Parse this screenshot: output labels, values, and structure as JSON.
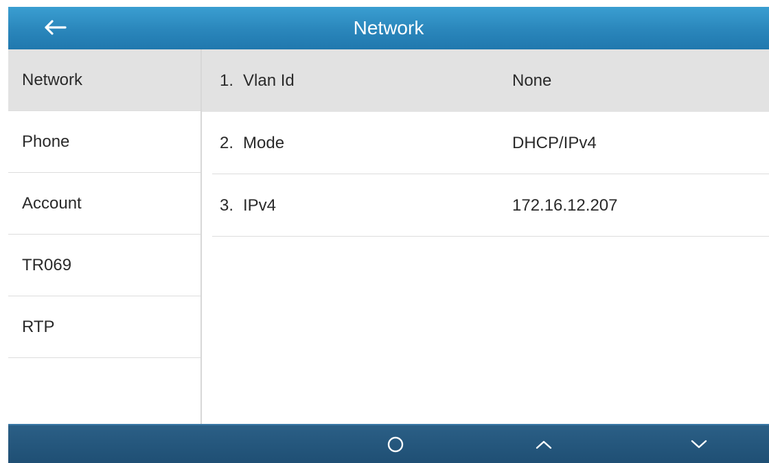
{
  "header": {
    "title": "Network",
    "back_icon": "arrow-left-icon"
  },
  "sidebar": {
    "items": [
      {
        "label": "Network",
        "active": true
      },
      {
        "label": "Phone",
        "active": false
      },
      {
        "label": "Account",
        "active": false
      },
      {
        "label": "TR069",
        "active": false
      },
      {
        "label": "RTP",
        "active": false
      }
    ]
  },
  "main": {
    "rows": [
      {
        "num": "1.",
        "label": "Vlan Id",
        "value": "None"
      },
      {
        "num": "2.",
        "label": "Mode",
        "value": "DHCP/IPv4"
      },
      {
        "num": "3.",
        "label": "IPv4",
        "value": "172.16.12.207"
      }
    ]
  },
  "softkeys": {
    "icons": [
      "circle-icon",
      "chevron-up-icon",
      "chevron-down-icon"
    ]
  },
  "colors": {
    "titlebar": "#2a86bb",
    "softkey_bar": "#1f4f74",
    "selected_row": "#e2e2e2"
  }
}
